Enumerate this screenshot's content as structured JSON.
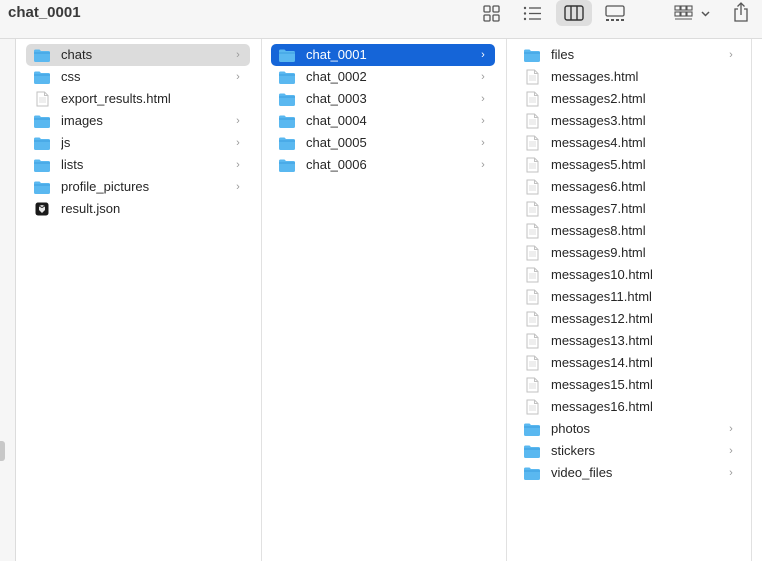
{
  "window": {
    "title": "chat_0001"
  },
  "toolbar": {
    "buttons": [
      {
        "name": "icon-view-button",
        "icon": "grid-icon"
      },
      {
        "name": "list-view-button",
        "icon": "list-icon"
      },
      {
        "name": "column-view-button",
        "icon": "columns-icon",
        "active": true
      },
      {
        "name": "gallery-view-button",
        "icon": "gallery-icon"
      },
      {
        "name": "group-by-button",
        "icon": "group-icon"
      },
      {
        "name": "share-button",
        "icon": "share-icon"
      }
    ]
  },
  "columns": [
    {
      "items": [
        {
          "label": "chats",
          "type": "folder",
          "chevron": "›",
          "selected": "gray"
        },
        {
          "label": "css",
          "type": "folder",
          "chevron": "›"
        },
        {
          "label": "export_results.html",
          "type": "file"
        },
        {
          "label": "images",
          "type": "folder",
          "chevron": "›"
        },
        {
          "label": "js",
          "type": "folder",
          "chevron": "›"
        },
        {
          "label": "lists",
          "type": "folder",
          "chevron": "›"
        },
        {
          "label": "profile_pictures",
          "type": "folder",
          "chevron": "›"
        },
        {
          "label": "result.json",
          "type": "json"
        }
      ]
    },
    {
      "items": [
        {
          "label": "chat_0001",
          "type": "folder",
          "chevron": "›",
          "selected": "blue"
        },
        {
          "label": "chat_0002",
          "type": "folder",
          "chevron": "›"
        },
        {
          "label": "chat_0003",
          "type": "folder",
          "chevron": "›"
        },
        {
          "label": "chat_0004",
          "type": "folder",
          "chevron": "›"
        },
        {
          "label": "chat_0005",
          "type": "folder",
          "chevron": "›"
        },
        {
          "label": "chat_0006",
          "type": "folder",
          "chevron": "›"
        }
      ]
    },
    {
      "items": [
        {
          "label": "files",
          "type": "folder",
          "chevron": "›"
        },
        {
          "label": "messages.html",
          "type": "file"
        },
        {
          "label": "messages2.html",
          "type": "file"
        },
        {
          "label": "messages3.html",
          "type": "file"
        },
        {
          "label": "messages4.html",
          "type": "file"
        },
        {
          "label": "messages5.html",
          "type": "file"
        },
        {
          "label": "messages6.html",
          "type": "file"
        },
        {
          "label": "messages7.html",
          "type": "file"
        },
        {
          "label": "messages8.html",
          "type": "file"
        },
        {
          "label": "messages9.html",
          "type": "file"
        },
        {
          "label": "messages10.html",
          "type": "file"
        },
        {
          "label": "messages11.html",
          "type": "file"
        },
        {
          "label": "messages12.html",
          "type": "file"
        },
        {
          "label": "messages13.html",
          "type": "file"
        },
        {
          "label": "messages14.html",
          "type": "file"
        },
        {
          "label": "messages15.html",
          "type": "file"
        },
        {
          "label": "messages16.html",
          "type": "file"
        },
        {
          "label": "photos",
          "type": "folder",
          "chevron": "›"
        },
        {
          "label": "stickers",
          "type": "folder",
          "chevron": "›"
        },
        {
          "label": "video_files",
          "type": "folder",
          "chevron": "›"
        }
      ]
    }
  ],
  "colors": {
    "folder": "#5ab8f0",
    "folder_dark": "#3a9ee0",
    "selection_blue": "#1565d8",
    "selection_gray": "#dcdcdc"
  }
}
